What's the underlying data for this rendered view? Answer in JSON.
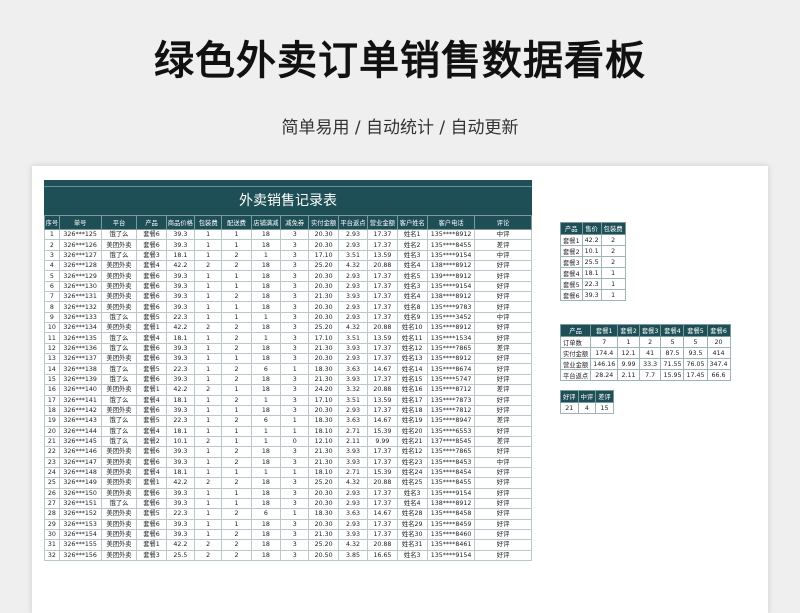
{
  "page": {
    "title": "绿色外卖订单销售数据看板",
    "subtitle": "简单易用 / 自动统计 / 自动更新"
  },
  "main": {
    "title": "外卖销售记录表",
    "headers": [
      "序号",
      "单号",
      "平台",
      "产品",
      "商品价格",
      "包装费",
      "配送费",
      "店铺满减",
      "减免券",
      "实付金额",
      "平台返点",
      "营业金额",
      "客户姓名",
      "客户电话",
      "评论"
    ],
    "rows": [
      [
        "1",
        "326***125",
        "饿了么",
        "套餐6",
        "39.3",
        "1",
        "1",
        "18",
        "3",
        "20.30",
        "2.93",
        "17.37",
        "姓名1",
        "135****8912",
        "中评"
      ],
      [
        "2",
        "326***126",
        "美团外卖",
        "套餐6",
        "39.3",
        "1",
        "1",
        "18",
        "3",
        "20.30",
        "2.93",
        "17.37",
        "姓名2",
        "135****8455",
        "差评"
      ],
      [
        "3",
        "326***127",
        "饿了么",
        "套餐3",
        "18.1",
        "1",
        "2",
        "1",
        "3",
        "17.10",
        "3.51",
        "13.59",
        "姓名3",
        "135****9154",
        "中评"
      ],
      [
        "4",
        "326***128",
        "美团外卖",
        "套餐4",
        "42.2",
        "2",
        "2",
        "18",
        "3",
        "25.20",
        "4.32",
        "20.88",
        "姓名4",
        "138****8912",
        "好评"
      ],
      [
        "5",
        "326***129",
        "美团外卖",
        "套餐6",
        "39.3",
        "1",
        "1",
        "18",
        "3",
        "20.30",
        "2.93",
        "17.37",
        "姓名5",
        "139****8912",
        "好评"
      ],
      [
        "6",
        "326***130",
        "美团外卖",
        "套餐6",
        "39.3",
        "1",
        "1",
        "18",
        "3",
        "20.30",
        "2.93",
        "17.37",
        "姓名3",
        "135****9154",
        "好评"
      ],
      [
        "7",
        "326***131",
        "美团外卖",
        "套餐6",
        "39.3",
        "1",
        "2",
        "18",
        "3",
        "21.30",
        "3.93",
        "17.37",
        "姓名4",
        "138****8912",
        "好评"
      ],
      [
        "8",
        "326***132",
        "美团外卖",
        "套餐6",
        "39.3",
        "1",
        "1",
        "18",
        "3",
        "20.30",
        "2.93",
        "17.37",
        "姓名8",
        "135****9783",
        "好评"
      ],
      [
        "9",
        "326***133",
        "饿了么",
        "套餐5",
        "22.3",
        "1",
        "1",
        "1",
        "3",
        "20.30",
        "2.93",
        "17.37",
        "姓名9",
        "135****3452",
        "中评"
      ],
      [
        "10",
        "326***134",
        "美团外卖",
        "套餐1",
        "42.2",
        "2",
        "2",
        "18",
        "3",
        "25.20",
        "4.32",
        "20.88",
        "姓名10",
        "135****8912",
        "好评"
      ],
      [
        "11",
        "326***135",
        "饿了么",
        "套餐4",
        "18.1",
        "1",
        "2",
        "1",
        "3",
        "17.10",
        "3.51",
        "13.59",
        "姓名11",
        "135****1534",
        "好评"
      ],
      [
        "12",
        "326***136",
        "饿了么",
        "套餐6",
        "39.3",
        "1",
        "2",
        "18",
        "3",
        "21.30",
        "3.93",
        "17.37",
        "姓名12",
        "135****7865",
        "差评"
      ],
      [
        "13",
        "326***137",
        "美团外卖",
        "套餐6",
        "39.3",
        "1",
        "1",
        "18",
        "3",
        "20.30",
        "2.93",
        "17.37",
        "姓名13",
        "135****8912",
        "好评"
      ],
      [
        "14",
        "326***138",
        "饿了么",
        "套餐5",
        "22.3",
        "1",
        "2",
        "6",
        "1",
        "18.30",
        "3.63",
        "14.67",
        "姓名14",
        "135****8674",
        "好评"
      ],
      [
        "15",
        "326***139",
        "饿了么",
        "套餐6",
        "39.3",
        "1",
        "2",
        "18",
        "3",
        "21.30",
        "3.93",
        "17.37",
        "姓名15",
        "135****5747",
        "好评"
      ],
      [
        "16",
        "326***140",
        "美团外卖",
        "套餐1",
        "42.2",
        "2",
        "1",
        "18",
        "3",
        "24.20",
        "3.32",
        "20.88",
        "姓名16",
        "135****8712",
        "差评"
      ],
      [
        "17",
        "326***141",
        "饿了么",
        "套餐4",
        "18.1",
        "1",
        "2",
        "1",
        "3",
        "17.10",
        "3.51",
        "13.59",
        "姓名17",
        "135****7873",
        "好评"
      ],
      [
        "18",
        "326***142",
        "美团外卖",
        "套餐6",
        "39.3",
        "1",
        "1",
        "18",
        "3",
        "20.30",
        "2.93",
        "17.37",
        "姓名18",
        "135****7812",
        "好评"
      ],
      [
        "19",
        "326***143",
        "饿了么",
        "套餐5",
        "22.3",
        "1",
        "2",
        "6",
        "1",
        "18.30",
        "3.63",
        "14.67",
        "姓名19",
        "135****8947",
        "差评"
      ],
      [
        "20",
        "326***144",
        "饿了么",
        "套餐4",
        "18.1",
        "1",
        "1",
        "1",
        "1",
        "18.10",
        "2.71",
        "15.39",
        "姓名20",
        "135****6553",
        "好评"
      ],
      [
        "21",
        "326***145",
        "饿了么",
        "套餐2",
        "10.1",
        "2",
        "1",
        "1",
        "0",
        "12.10",
        "2.11",
        "9.99",
        "姓名21",
        "137****8545",
        "差评"
      ],
      [
        "22",
        "326***146",
        "美团外卖",
        "套餐6",
        "39.3",
        "1",
        "2",
        "18",
        "3",
        "21.30",
        "3.93",
        "17.37",
        "姓名12",
        "135****7865",
        "好评"
      ],
      [
        "23",
        "326***147",
        "美团外卖",
        "套餐6",
        "39.3",
        "1",
        "2",
        "18",
        "3",
        "21.30",
        "3.93",
        "17.37",
        "姓名23",
        "135****8453",
        "中评"
      ],
      [
        "24",
        "326***148",
        "美团外卖",
        "套餐4",
        "18.1",
        "1",
        "1",
        "1",
        "1",
        "18.10",
        "2.71",
        "15.39",
        "姓名24",
        "135****8454",
        "好评"
      ],
      [
        "25",
        "326***149",
        "美团外卖",
        "套餐1",
        "42.2",
        "2",
        "2",
        "18",
        "3",
        "25.20",
        "4.32",
        "20.88",
        "姓名25",
        "135****8455",
        "好评"
      ],
      [
        "26",
        "326***150",
        "美团外卖",
        "套餐6",
        "39.3",
        "1",
        "1",
        "18",
        "3",
        "20.30",
        "2.93",
        "17.37",
        "姓名3",
        "135****9154",
        "好评"
      ],
      [
        "27",
        "326***151",
        "饿了么",
        "套餐6",
        "39.3",
        "1",
        "1",
        "18",
        "3",
        "20.30",
        "2.93",
        "17.37",
        "姓名4",
        "138****8912",
        "好评"
      ],
      [
        "28",
        "326***152",
        "美团外卖",
        "套餐5",
        "22.3",
        "1",
        "2",
        "6",
        "1",
        "18.30",
        "3.63",
        "14.67",
        "姓名28",
        "135****8458",
        "好评"
      ],
      [
        "29",
        "326***153",
        "美团外卖",
        "套餐6",
        "39.3",
        "1",
        "1",
        "18",
        "3",
        "20.30",
        "2.93",
        "17.37",
        "姓名29",
        "135****8459",
        "好评"
      ],
      [
        "30",
        "326***154",
        "美团外卖",
        "套餐6",
        "39.3",
        "1",
        "2",
        "18",
        "3",
        "21.30",
        "3.93",
        "17.37",
        "姓名30",
        "135****8460",
        "好评"
      ],
      [
        "31",
        "326***155",
        "美团外卖",
        "套餐1",
        "42.2",
        "2",
        "2",
        "18",
        "3",
        "25.20",
        "4.32",
        "20.88",
        "姓名31",
        "135****8461",
        "好评"
      ],
      [
        "32",
        "326***156",
        "美团外卖",
        "套餐3",
        "25.5",
        "2",
        "2",
        "18",
        "3",
        "20.50",
        "3.85",
        "16.65",
        "姓名3",
        "135****9154",
        "好评"
      ]
    ]
  },
  "price_table": {
    "headers": [
      "产品",
      "售价",
      "包装费"
    ],
    "rows": [
      [
        "套餐1",
        "42.2",
        "2"
      ],
      [
        "套餐2",
        "10.1",
        "2"
      ],
      [
        "套餐3",
        "25.5",
        "2"
      ],
      [
        "套餐4",
        "18.1",
        "1"
      ],
      [
        "套餐5",
        "22.3",
        "1"
      ],
      [
        "套餐6",
        "39.3",
        "1"
      ]
    ]
  },
  "stats_table": {
    "headers": [
      "产品",
      "套餐1",
      "套餐2",
      "套餐3",
      "套餐4",
      "套餐5",
      "套餐6"
    ],
    "rows": [
      [
        "订单数",
        "7",
        "1",
        "2",
        "5",
        "5",
        "20"
      ],
      [
        "实付金额",
        "174.4",
        "12.1",
        "41",
        "87.5",
        "93.5",
        "414"
      ],
      [
        "营业金额",
        "146.16",
        "9.99",
        "33.3",
        "71.55",
        "76.05",
        "347.4"
      ],
      [
        "平台返点",
        "28.24",
        "2.11",
        "7.7",
        "15.95",
        "17.45",
        "66.6"
      ]
    ]
  },
  "review_table": {
    "headers": [
      "好评",
      "中评",
      "差评"
    ],
    "rows": [
      [
        "21",
        "4",
        "15"
      ]
    ]
  }
}
